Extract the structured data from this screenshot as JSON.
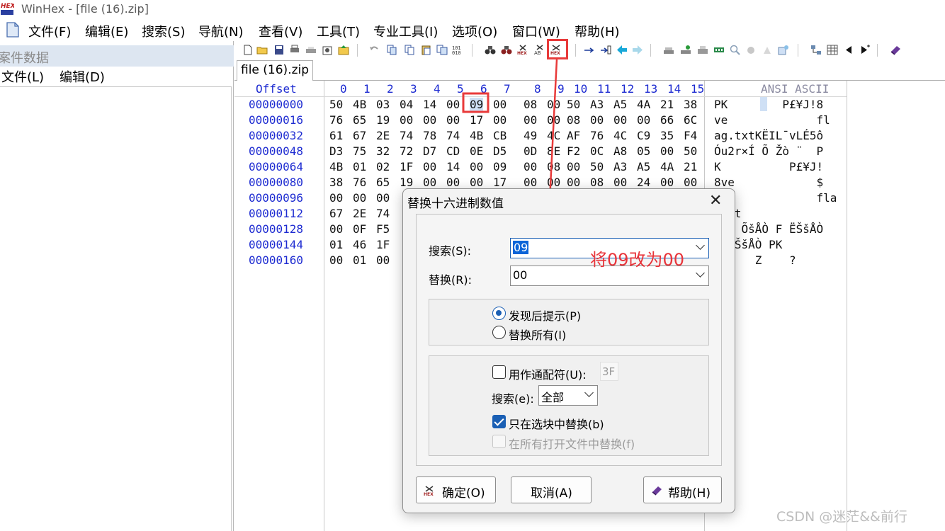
{
  "window": {
    "title": "WinHex - [file (16).zip]"
  },
  "menu": [
    "文件(F)",
    "编辑(E)",
    "搜索(S)",
    "导航(N)",
    "查看(V)",
    "工具(T)",
    "专业工具(I)",
    "选项(O)",
    "窗口(W)",
    "帮助(H)"
  ],
  "left_panel": {
    "title": "案件数据",
    "menu_file": "文件(L)",
    "menu_edit": "编辑(D)"
  },
  "tab": {
    "label": "file (16).zip"
  },
  "hex": {
    "offset_header": "Offset",
    "columns": [
      "0",
      "1",
      "2",
      "3",
      "4",
      "5",
      "6",
      "7",
      "8",
      "9",
      "10",
      "11",
      "12",
      "13",
      "14",
      "15"
    ],
    "ascii_header": "ANSI ASCII",
    "rows": [
      {
        "offset": "00000000",
        "bytes": [
          "50",
          "4B",
          "03",
          "04",
          "14",
          "00",
          "09",
          "00",
          "08",
          "00",
          "50",
          "A3",
          "A5",
          "4A",
          "21",
          "38"
        ],
        "ascii": "PK        P£¥J!8"
      },
      {
        "offset": "00000016",
        "bytes": [
          "76",
          "65",
          "19",
          "00",
          "00",
          "00",
          "17",
          "00",
          "00",
          "00",
          "08",
          "00",
          "00",
          "00",
          "66",
          "6C"
        ],
        "ascii": "ve             fl"
      },
      {
        "offset": "00000032",
        "bytes": [
          "61",
          "67",
          "2E",
          "74",
          "78",
          "74",
          "4B",
          "CB",
          "49",
          "4C",
          "AF",
          "76",
          "4C",
          "C9",
          "35",
          "F4"
        ],
        "ascii": "ag.txtKËIL¯vLÉ5ô"
      },
      {
        "offset": "00000048",
        "bytes": [
          "D3",
          "75",
          "32",
          "72",
          "D7",
          "CD",
          "0E",
          "D5",
          "0D",
          "8E",
          "F2",
          "0C",
          "A8",
          "05",
          "00",
          "50"
        ],
        "ascii": "Óu2r×Í Õ Žò ¨  P"
      },
      {
        "offset": "00000064",
        "bytes": [
          "4B",
          "01",
          "02",
          "1F",
          "00",
          "14",
          "00",
          "09",
          "00",
          "08",
          "00",
          "50",
          "A3",
          "A5",
          "4A",
          "21"
        ],
        "ascii": "K          P£¥J!"
      },
      {
        "offset": "00000080",
        "bytes": [
          "38",
          "76",
          "65",
          "19",
          "00",
          "00",
          "00",
          "17",
          "00",
          "00",
          "00",
          "08",
          "00",
          "24",
          "00",
          "00"
        ],
        "ascii": "8ve            $"
      },
      {
        "offset": "00000096",
        "bytes": [
          "00",
          "00",
          "00"
        ],
        "ascii": "               fla"
      },
      {
        "offset": "00000112",
        "bytes": [
          "67",
          "2E",
          "74"
        ],
        "ascii": "  xt"
      },
      {
        "offset": "00000128",
        "bytes": [
          "00",
          "0F",
          "F5"
        ],
        "ascii": "  õ ÕšÅÒ F ËŠšÅÒ"
      },
      {
        "offset": "00000144",
        "bytes": [
          "01",
          "46",
          "1F"
        ],
        "ascii": "  ËŠšÅÒ PK"
      },
      {
        "offset": "00000160",
        "bytes": [
          "00",
          "01",
          "00"
        ],
        "ascii": "      Z    ?"
      }
    ]
  },
  "dialog": {
    "title": "替换十六进制数值",
    "search_label": "搜索(S):",
    "search_value": "09",
    "replace_label": "替换(R):",
    "replace_value": "00",
    "radio_prompt": "发现后提示(P)",
    "radio_all": "替换所有(I)",
    "wildcard_label": "用作通配符(U):",
    "wildcard_value": "3F",
    "search_scope_label": "搜索(e):",
    "search_scope_value": "全部",
    "only_in_block": "只在选块中替换(b)",
    "all_open_files": "在所有打开文件中替换(f)",
    "ok_button": "确定(O)",
    "cancel_button": "取消(A)",
    "help_button": "帮助(H)"
  },
  "annotation": {
    "text": "将09改为00",
    "color": "#e8343a"
  },
  "watermark": "CSDN @迷茫&&前行"
}
